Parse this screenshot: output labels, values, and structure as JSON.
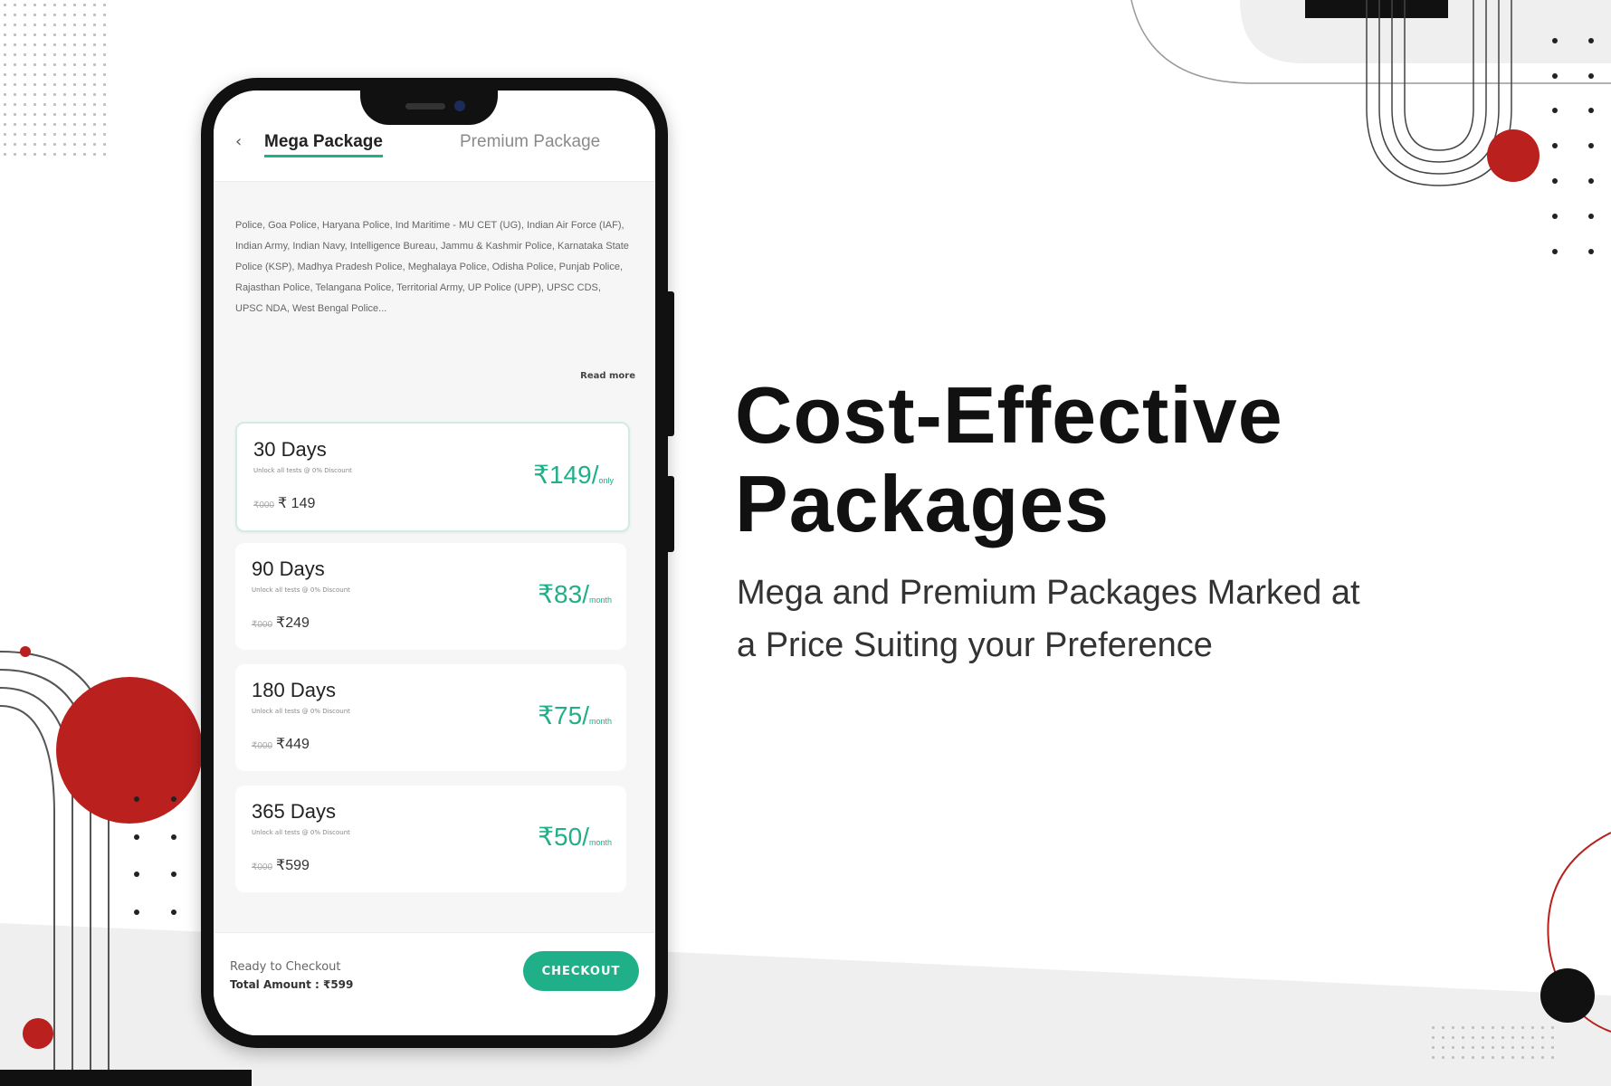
{
  "hero": {
    "title_line1": "Cost-Effective",
    "title_line2": "Packages",
    "subtitle_line1": "Mega and Premium Packages Marked at",
    "subtitle_line2": "a Price Suiting your Preference"
  },
  "app": {
    "tabs": [
      {
        "label": "Mega Package",
        "active": true
      },
      {
        "label": "Premium Package",
        "active": false
      }
    ],
    "back_icon": "chevron-left-icon",
    "description": "Police, Goa Police, Haryana Police, Ind Maritime - MU CET (UG), Indian Air Force (IAF), Indian Army, Indian Navy, Intelligence Bureau, Jammu & Kashmir Police, Karnataka State Police (KSP), Madhya Pradesh Police, Meghalaya Police, Odisha Police, Punjab Police, Rajasthan Police, Telangana Police, Territorial Army, UP Police (UPP), UPSC CDS, UPSC NDA, West Bengal Police...",
    "read_more": "Read more",
    "packages": [
      {
        "days": "30 Days",
        "note": "Unlock all tests @ 0% Discount",
        "orig_strike": "₹000",
        "orig": "₹ 149",
        "price": "₹149/",
        "unit": "only",
        "selected": true
      },
      {
        "days": "90 Days",
        "note": "Unlock all tests @ 0% Discount",
        "orig_strike": "₹000",
        "orig": "₹249",
        "price": "₹83/",
        "unit": "month",
        "selected": false
      },
      {
        "days": "180 Days",
        "note": "Unlock all tests @ 0% Discount",
        "orig_strike": "₹000",
        "orig": "₹449",
        "price": "₹75/",
        "unit": "month",
        "selected": false
      },
      {
        "days": "365 Days",
        "note": "Unlock all tests @ 0% Discount",
        "orig_strike": "₹000",
        "orig": "₹599",
        "price": "₹50/",
        "unit": "month",
        "selected": false
      }
    ],
    "footer": {
      "ready": "Ready to Checkout",
      "total": "Total Amount : ₹599",
      "checkout": "CHECKOUT"
    }
  },
  "colors": {
    "accent_green": "#1fb08a",
    "decor_red": "#b9201e",
    "background": "#ffffff"
  }
}
